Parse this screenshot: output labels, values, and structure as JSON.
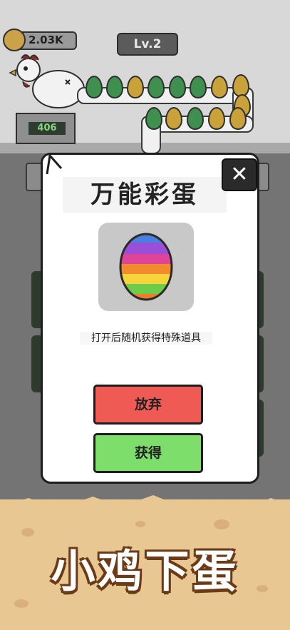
{
  "hud": {
    "coins": "2.03K",
    "level": "Lv.2",
    "crate_count": "406"
  },
  "dialog": {
    "title": "万能彩蛋",
    "description": "打开后随机获得特殊道具",
    "quit_button": "放弃",
    "get_button": "获得",
    "close_label": "✕"
  },
  "banner": {
    "title": "小鸡下蛋"
  },
  "colors": {
    "quit": "#f05a55",
    "get": "#7dde6c",
    "ground": "#e8c793",
    "title_outline": "#6b3a17"
  },
  "icons": [
    "coin-icon",
    "chicken-icon",
    "rainbow-egg-icon",
    "close-icon"
  ]
}
